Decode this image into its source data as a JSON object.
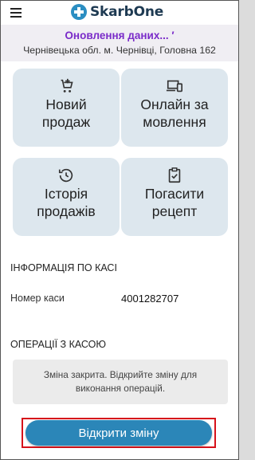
{
  "app": {
    "logo_text": "SkarbOne",
    "menu_icon": "hamburger-menu-icon"
  },
  "status": {
    "updating_text": "Оновлення даних... ′",
    "address": "Чернівецька обл. м. Чернівці, Головна 162"
  },
  "tiles": [
    {
      "label": "Новий продаж",
      "icon": "cart-plus-icon"
    },
    {
      "label": "Онлайн замовлення",
      "icon": "devices-icon"
    },
    {
      "label": "Історія продажів",
      "icon": "history-icon"
    },
    {
      "label": "Погасити рецепт",
      "icon": "clipboard-check-icon"
    }
  ],
  "cash_info": {
    "title": "ІНФОРМАЦІЯ ПО КАСІ",
    "register_label": "Номер каси",
    "register_value": "4001282707"
  },
  "operations": {
    "title": "ОПЕРАЦІЇ З КАСОЮ",
    "notice": "Зміна закрита. Відкрийте зміну для виконання операцій.",
    "open_shift_label": "Відкрити зміну"
  },
  "colors": {
    "accent": "#2b86b8",
    "updating": "#7a2bc9",
    "tile_bg": "#dde7ee",
    "highlight": "#d6111a"
  }
}
